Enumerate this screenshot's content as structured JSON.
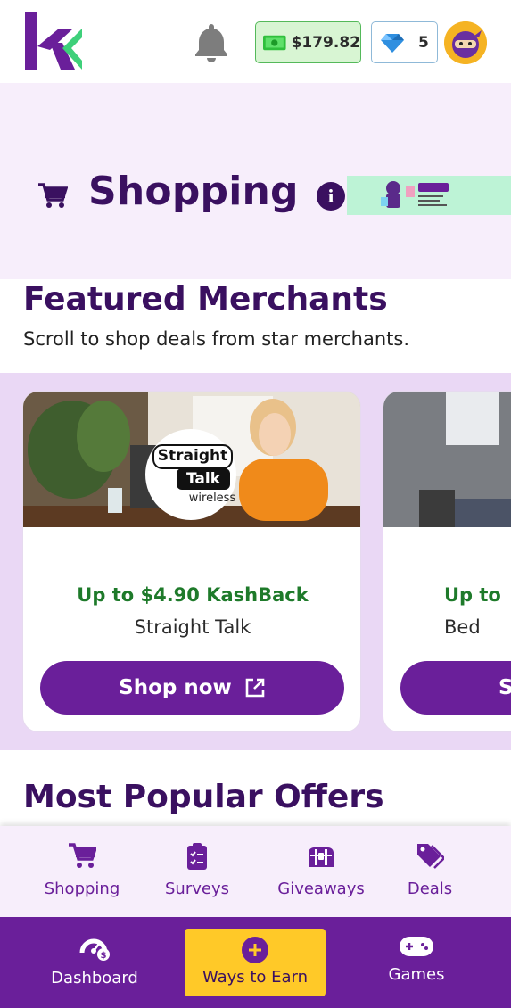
{
  "header": {
    "cash_balance": "$179.82",
    "gem_count": "5",
    "icons": [
      "kashkick-logo",
      "bell-icon",
      "cash-icon",
      "gem-icon",
      "avatar"
    ]
  },
  "hero": {
    "title": "Shopping",
    "icons": [
      "cart-icon",
      "info-icon"
    ]
  },
  "featured": {
    "title": "Featured Merchants",
    "subtitle": "Scroll to shop deals from star merchants."
  },
  "merchants": [
    {
      "kashback": "Up to $4.90 KashBack",
      "name": "Straight Talk",
      "logo_line1": "Straight",
      "logo_line2": "Talk",
      "logo_line3": "wireless",
      "button": "Shop now"
    },
    {
      "kashback": "Up to",
      "name": "Bed",
      "button": "S"
    }
  ],
  "popular": {
    "title": "Most Popular Offers"
  },
  "subnav": [
    {
      "label": "Shopping",
      "icon": "cart-icon"
    },
    {
      "label": "Surveys",
      "icon": "clipboard-icon"
    },
    {
      "label": "Giveaways",
      "icon": "treasure-chest-icon"
    },
    {
      "label": "Deals",
      "icon": "tags-icon"
    }
  ],
  "bottomnav": [
    {
      "label": "Dashboard",
      "icon": "dashboard-icon"
    },
    {
      "label": "Ways to Earn",
      "icon": "plus-circle-icon",
      "active": true
    },
    {
      "label": "Games",
      "icon": "gamepad-icon"
    }
  ],
  "colors": {
    "brand_purple": "#6a1f9a",
    "dark_purple": "#3a1060",
    "kashback_green": "#1e7a2a",
    "highlight_yellow": "#ffc928"
  }
}
